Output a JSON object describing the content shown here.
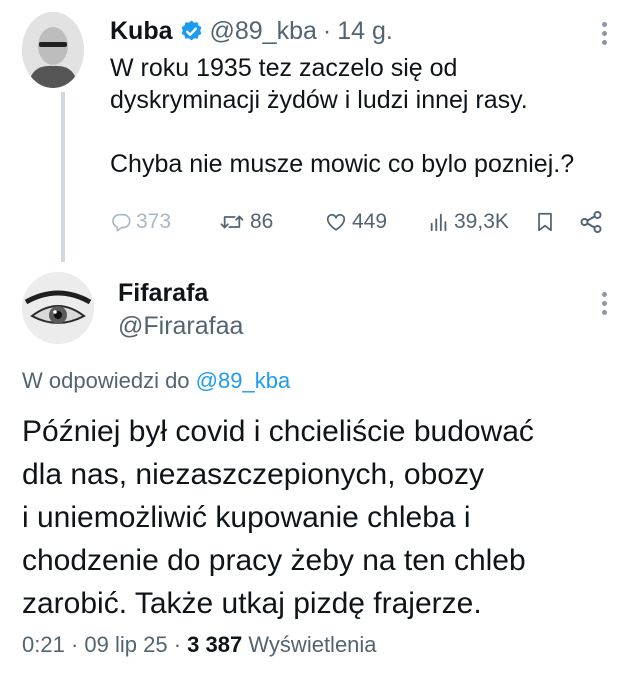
{
  "parent_tweet": {
    "author_name": "Kuba",
    "handle": "@89_kba",
    "separator": "·",
    "time_ago": "14 g.",
    "text_lines": [
      "W roku 1935 tez zaczelo się od",
      "dyskryminacji żydów i ludzi innej rasy.",
      "Chyba nie musze mowic co bylo pozniej.?"
    ],
    "actions": {
      "replies": "373",
      "retweets": "86",
      "likes": "449",
      "views": "39,3K"
    },
    "icons": [
      "verified-badge-icon",
      "more-options-icon",
      "reply-icon",
      "retweet-icon",
      "like-icon",
      "views-icon",
      "bookmark-icon",
      "share-icon"
    ]
  },
  "reply_tweet": {
    "author_name": "Fifarafa",
    "handle": "@Firarafaa",
    "reply_prefix": "W odpowiedzi do",
    "reply_mention": "@89_kba",
    "text_lines": [
      "Później był covid i chcieliście budować",
      "dla nas, niezaszczepionych, obozy",
      "i uniemożliwić kupowanie chleba i",
      "chodzenie do pracy żeby na ten chleb",
      "zarobić. Także utkaj pizdę frajerze."
    ],
    "time": "0:21",
    "date": "09 lip 25",
    "separator": "·",
    "views_count": "3 387",
    "views_label": "Wyświetlenia"
  },
  "colors": {
    "text": "#0f1419",
    "secondary": "#536471",
    "accent": "#1d9bf0",
    "thread_line": "#cfd9de"
  }
}
